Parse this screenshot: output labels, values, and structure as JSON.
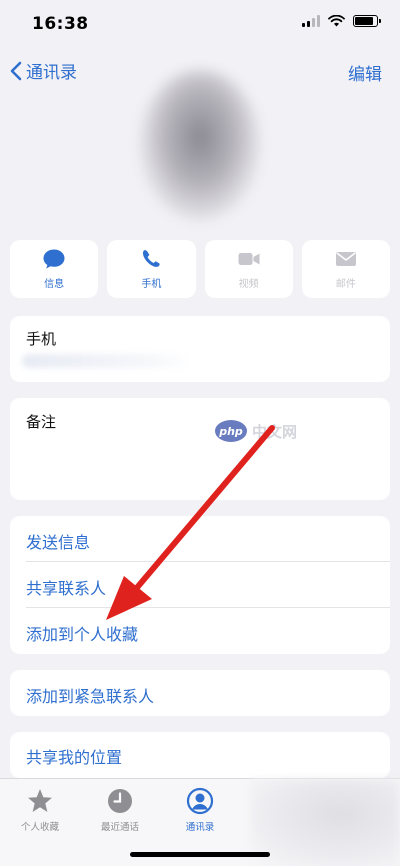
{
  "status_bar": {
    "time": "16:38",
    "battery_level": 0.85
  },
  "nav": {
    "back_label": "通讯录",
    "edit_label": "编辑"
  },
  "actions": [
    {
      "label": "信息",
      "icon": "message-bubble-icon",
      "enabled": true
    },
    {
      "label": "手机",
      "icon": "phone-icon",
      "enabled": true
    },
    {
      "label": "视频",
      "icon": "video-icon",
      "enabled": false
    },
    {
      "label": "邮件",
      "icon": "mail-icon",
      "enabled": false
    }
  ],
  "phone_card": {
    "label": "手机"
  },
  "notes_card": {
    "label": "备注"
  },
  "list_group_1": [
    {
      "label": "发送信息"
    },
    {
      "label": "共享联系人"
    },
    {
      "label": "添加到个人收藏"
    }
  ],
  "emergency": {
    "label": "添加到紧急联系人"
  },
  "share_location": {
    "label": "共享我的位置"
  },
  "watermark": {
    "logo": "php",
    "text": "中文网"
  },
  "tabs": [
    {
      "label": "个人收藏",
      "icon": "star-icon",
      "active": false
    },
    {
      "label": "最近通话",
      "icon": "clock-icon",
      "active": false
    },
    {
      "label": "通讯录",
      "icon": "person-circle-icon",
      "active": true
    }
  ],
  "colors": {
    "accent": "#2f6fcf",
    "background": "#f2f2f6",
    "arrow": "#e0221e"
  }
}
